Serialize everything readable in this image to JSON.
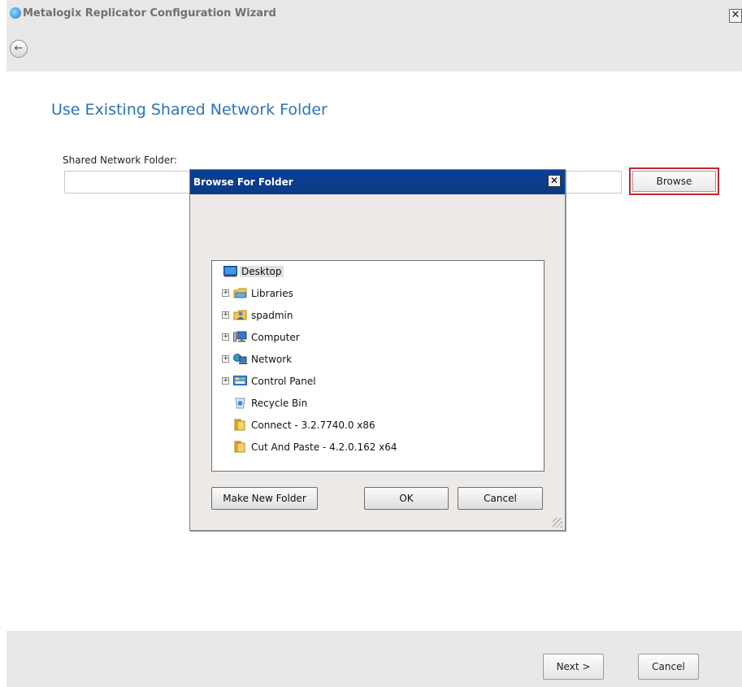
{
  "window": {
    "title": "Metalogix Replicator Configuration Wizard",
    "close_glyph": "✕",
    "back_glyph": "←"
  },
  "page": {
    "title": "Use Existing Shared Network Folder",
    "field_label": "Shared Network Folder:",
    "field_value": "",
    "browse_label": "Browse"
  },
  "footer": {
    "next_label": "Next >",
    "cancel_label": "Cancel"
  },
  "dialog": {
    "title": "Browse For Folder",
    "close_glyph": "✕",
    "tree": [
      {
        "label": "Desktop",
        "icon": "desktop-icon",
        "expandable": false,
        "selected": true
      },
      {
        "label": "Libraries",
        "icon": "libraries-icon",
        "expandable": true
      },
      {
        "label": "spadmin",
        "icon": "user-folder-icon",
        "expandable": true
      },
      {
        "label": "Computer",
        "icon": "computer-icon",
        "expandable": true
      },
      {
        "label": "Network",
        "icon": "network-icon",
        "expandable": true
      },
      {
        "label": "Control Panel",
        "icon": "control-panel-icon",
        "expandable": true
      },
      {
        "label": "Recycle Bin",
        "icon": "recycle-bin-icon",
        "expandable": false
      },
      {
        "label": "Connect - 3.2.7740.0 x86",
        "icon": "folder-icon",
        "expandable": false
      },
      {
        "label": "Cut And Paste - 4.2.0.162 x64",
        "icon": "folder-icon",
        "expandable": false
      }
    ],
    "make_new_folder_label": "Make New Folder",
    "ok_label": "OK",
    "cancel_label": "Cancel"
  }
}
